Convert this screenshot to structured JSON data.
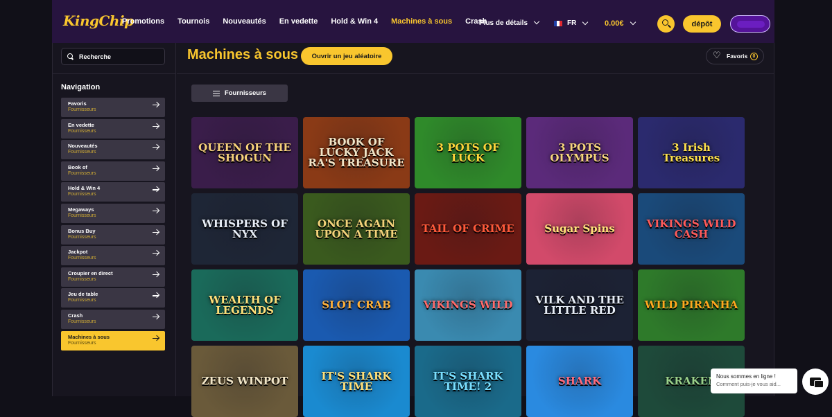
{
  "header": {
    "logo": "KingChip",
    "nav": [
      "Promotions",
      "Tournois",
      "Nouveautés",
      "En vedette",
      "Hold & Win 4",
      "Machines à sous",
      "Crash"
    ],
    "more": "Plus de détails",
    "language": "FR",
    "balance": "0.00€",
    "deposit": "dépôt"
  },
  "sidebar": {
    "search_placeholder": "Recherche",
    "nav_title": "Navigation",
    "items": [
      {
        "label": "Favoris",
        "sub": "Fournisseurs"
      },
      {
        "label": "En vedette",
        "sub": "Fournisseurs"
      },
      {
        "label": "Nouveautés",
        "sub": "Fournisseurs"
      },
      {
        "label": "Book of",
        "sub": "Fournisseurs"
      },
      {
        "label": "Hold & Win 4",
        "sub": "Fournisseurs"
      },
      {
        "label": "Megaways",
        "sub": "Fournisseurs"
      },
      {
        "label": "Bonus Buy",
        "sub": "Fournisseurs"
      },
      {
        "label": "Jackpot",
        "sub": "Fournisseurs"
      },
      {
        "label": "Croupier en direct",
        "sub": "Fournisseurs"
      },
      {
        "label": "Jeu de table",
        "sub": "Fournisseurs"
      },
      {
        "label": "Crash",
        "sub": "Fournisseurs"
      },
      {
        "label": "Machines à sous",
        "sub": "Fournisseurs"
      }
    ]
  },
  "main": {
    "title": "Machines à sous",
    "random_button": "Ouvrir un jeu aléatoire",
    "favorites_label": "Favoris",
    "favorites_count": "0",
    "providers_button": "Fournisseurs"
  },
  "games": [
    {
      "title": "QUEEN OF THE SHOGUN",
      "bg": "#3a1d4a",
      "fg": "#f7d27a"
    },
    {
      "title": "BOOK OF LUCKY JACK RA'S TREASURE",
      "bg": "#8a3a16",
      "fg": "#f2e6c8"
    },
    {
      "title": "3 POTS OF LUCK",
      "bg": "#2f8a2a",
      "fg": "#ffd43a"
    },
    {
      "title": "3 POTS OLYMPUS",
      "bg": "#5b2a7a",
      "fg": "#f6d57c"
    },
    {
      "title": "3 Irish Treasures",
      "bg": "#2b2a6e",
      "fg": "#ffe14a"
    },
    {
      "title": "WHISPERS OF NYX",
      "bg": "#1e2636",
      "fg": "#e8eef7"
    },
    {
      "title": "ONCE AGAIN UPON A TIME",
      "bg": "#3a5a1e",
      "fg": "#f3d27a"
    },
    {
      "title": "TAIL OF CRIME",
      "bg": "#6a1a14",
      "fg": "#ff5a3a"
    },
    {
      "title": "Sugar Spins",
      "bg": "#d24a6a",
      "fg": "#ffe27a"
    },
    {
      "title": "VIKINGS WILD CASH",
      "bg": "#1a4a7a",
      "fg": "#ff5a5a"
    },
    {
      "title": "WEALTH OF LEGENDS",
      "bg": "#1a6a5a",
      "fg": "#ffe07a"
    },
    {
      "title": "SLOT CRAB",
      "bg": "#1a5ab0",
      "fg": "#ffb03a"
    },
    {
      "title": "VIKINGS WILD",
      "bg": "#3a8ab0",
      "fg": "#ff6a6a"
    },
    {
      "title": "VILK AND THE LITTLE RED",
      "bg": "#1c2234",
      "fg": "#e8eef7"
    },
    {
      "title": "WILD PIRANHA",
      "bg": "#2e7a2a",
      "fg": "#ffa81e"
    },
    {
      "title": "ZEUS WINPOT",
      "bg": "#6a5a3a",
      "fg": "#f2e6c8"
    },
    {
      "title": "IT'S SHARK TIME",
      "bg": "#1a8ad0",
      "fg": "#ffe07a"
    },
    {
      "title": "IT'S SHARK TIME! 2",
      "bg": "#1a6a8a",
      "fg": "#7adfff"
    },
    {
      "title": "SHARK",
      "bg": "#2a8ae0",
      "fg": "#ff6a7a"
    },
    {
      "title": "KRAKEN",
      "bg": "#1e4a3a",
      "fg": "#9ad08a"
    }
  ],
  "chat": {
    "line1": "Nous sommes en ligne !",
    "line2": "Comment puis-je vous aid..."
  }
}
